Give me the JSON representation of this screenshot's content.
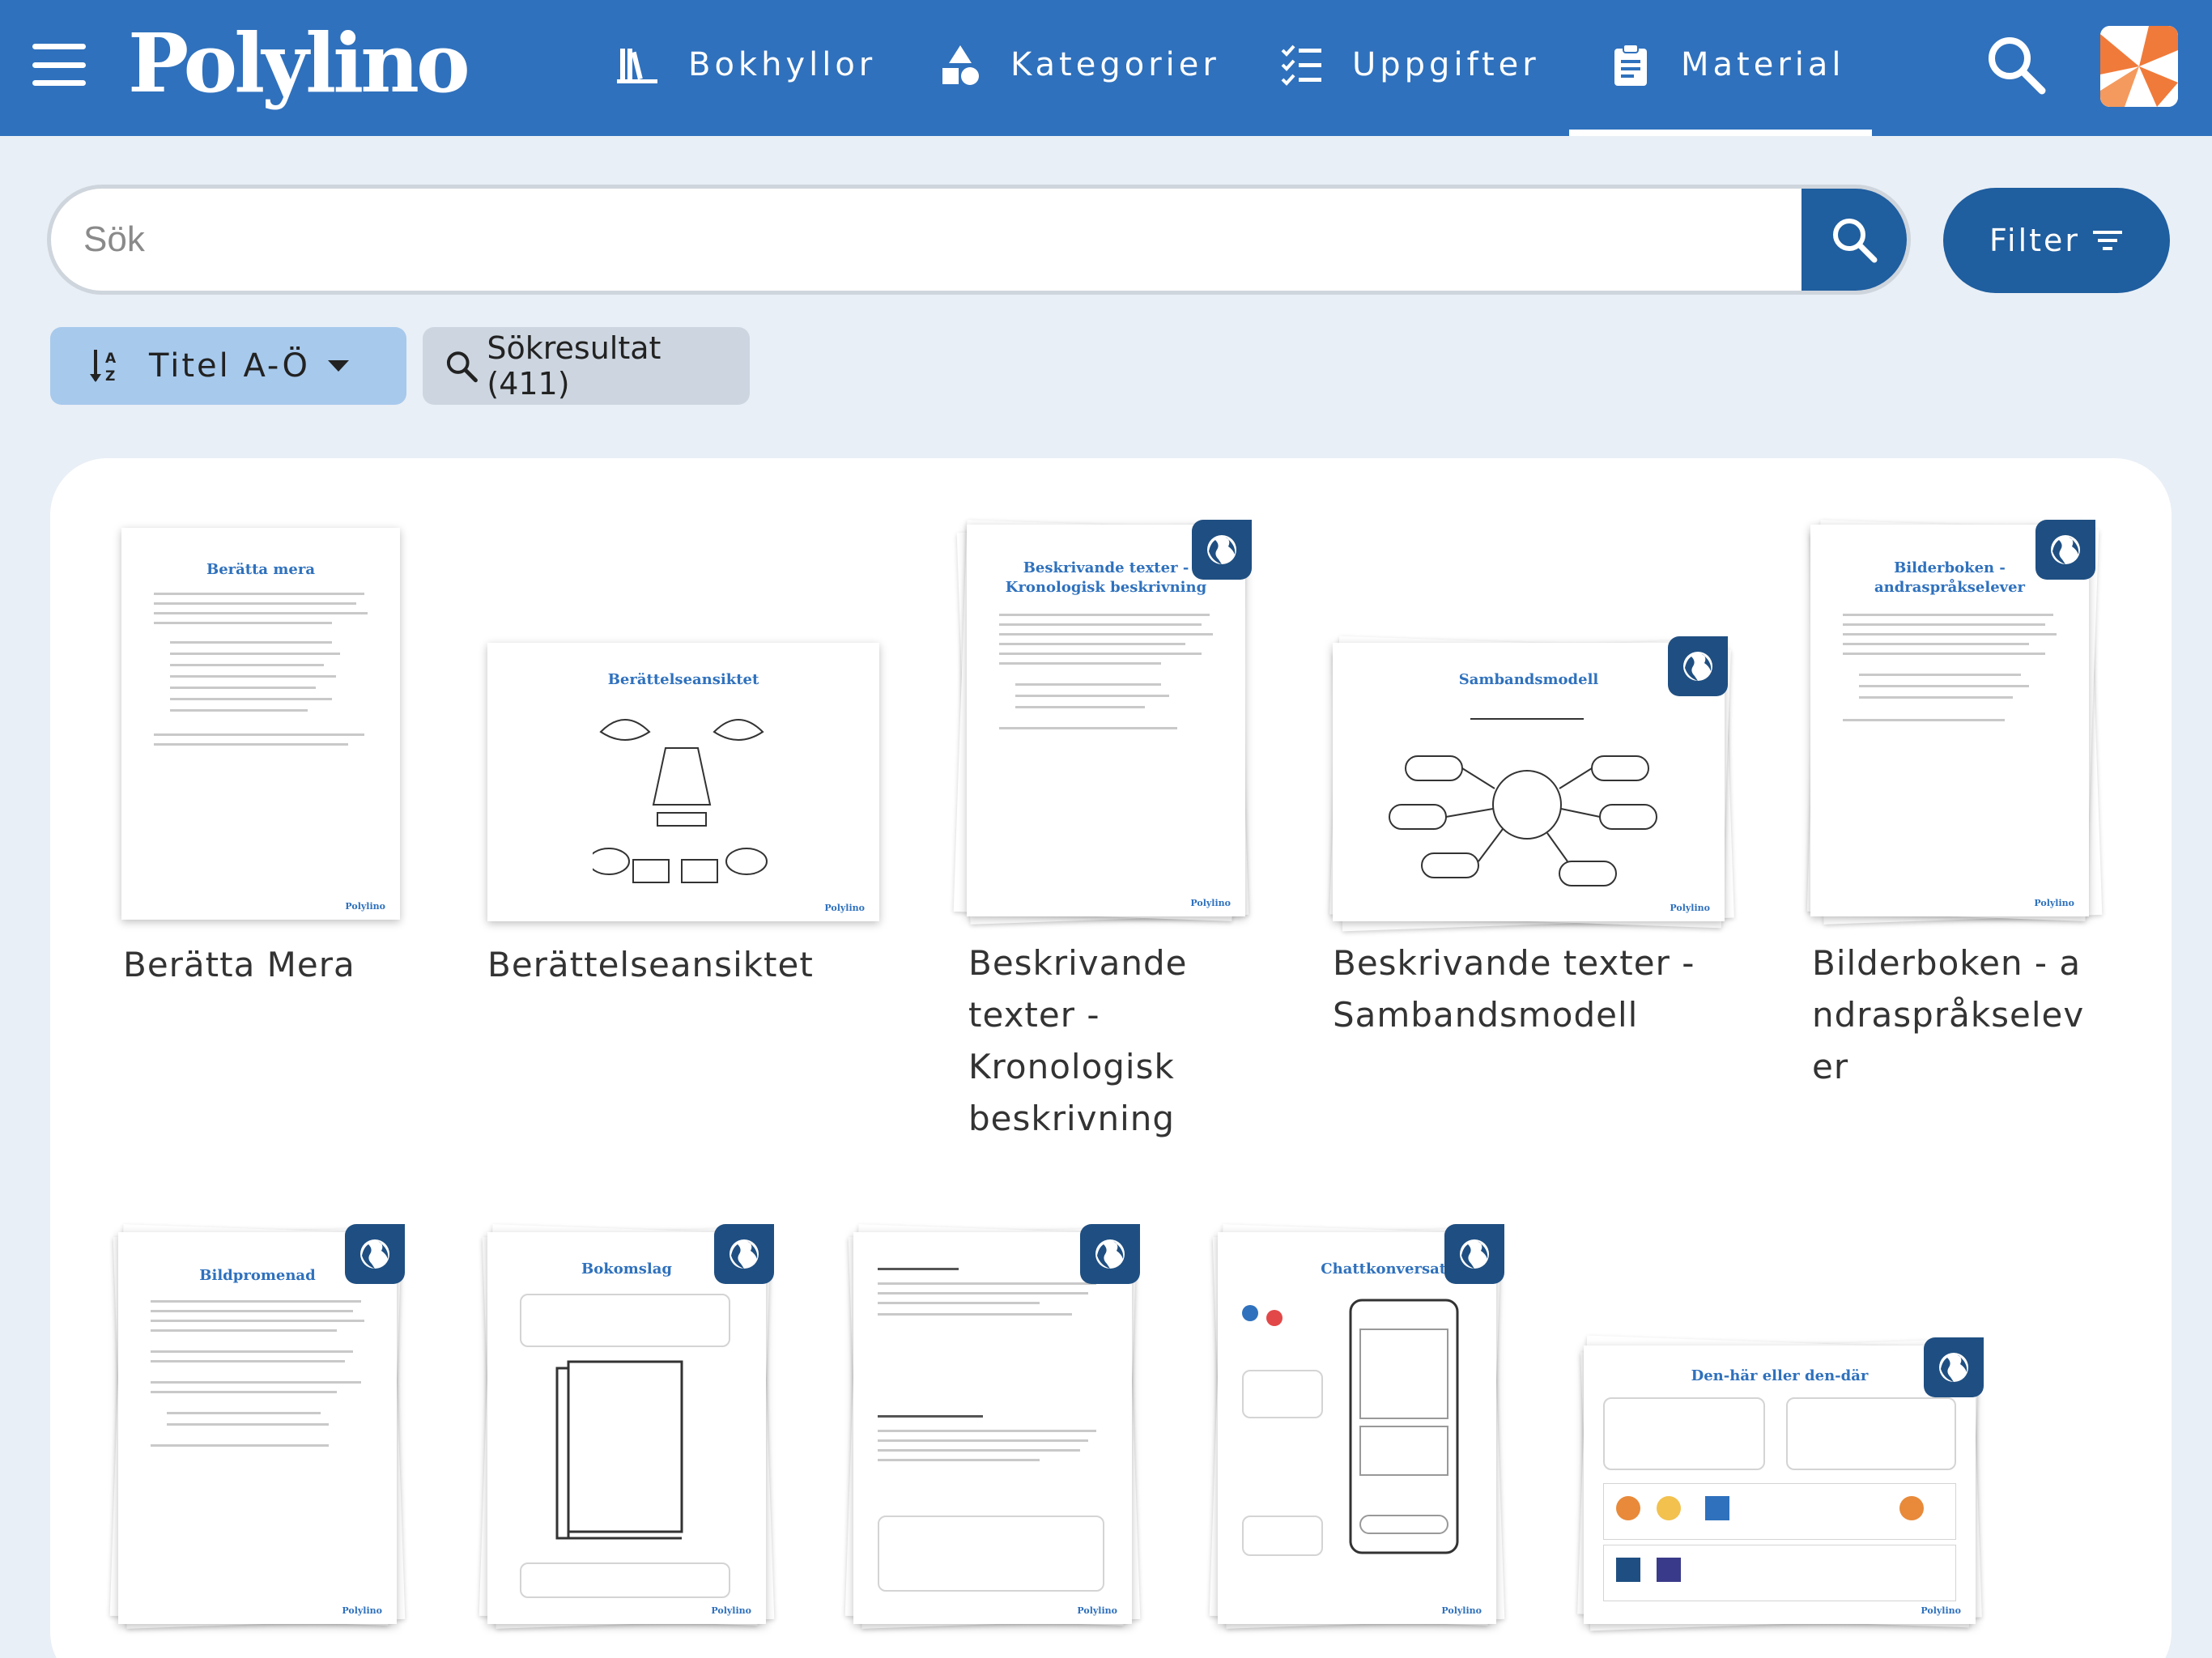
{
  "header": {
    "logo": "Polylino",
    "nav": [
      {
        "label": "Bokhyllor",
        "icon": "bookshelf-icon"
      },
      {
        "label": "Kategorier",
        "icon": "categories-icon"
      },
      {
        "label": "Uppgifter",
        "icon": "checklist-icon"
      },
      {
        "label": "Material",
        "icon": "clipboard-icon"
      }
    ],
    "active_nav": "Material"
  },
  "search": {
    "placeholder": "Sök"
  },
  "filter": {
    "label": "Filter"
  },
  "sort": {
    "label": "Titel A-Ö"
  },
  "results": {
    "label": "Sökresultat (411)"
  },
  "cards": [
    {
      "title": "Berätta Mera",
      "doc_title": "Berätta mera",
      "globe": false
    },
    {
      "title": "Berättelseansiktet",
      "doc_title": "Berättelseansiktet",
      "globe": false
    },
    {
      "title": "Beskrivande texter - Kronologisk beskrivning",
      "doc_title": "Beskrivande texter - Kronologisk beskrivning",
      "globe": true
    },
    {
      "title": "Beskrivande texter - Sambandsmodell",
      "doc_title": "Sambandsmodell",
      "globe": true
    },
    {
      "title": "Bilderboken - andraspråkselever",
      "doc_title": "Bilderboken - andraspråkselever",
      "globe": true
    },
    {
      "title": "Bildpromenad",
      "doc_title": "Bildpromenad",
      "globe": true
    },
    {
      "title": "Bokomslag",
      "doc_title": "Bokomslag",
      "globe": true
    },
    {
      "title": "",
      "doc_title": "",
      "globe": true
    },
    {
      "title": "",
      "doc_title": "Chattkonversation",
      "globe": true
    },
    {
      "title": "",
      "doc_title": "Den-här eller den-där",
      "globe": true
    }
  ],
  "brand_small": "Polylino",
  "colors": {
    "header": "#2f71bd",
    "dark_blue": "#1f5e9f",
    "sort_bg": "#a7c9ec",
    "chip_bg": "#cdd6e0",
    "page_bg": "#e9eff6"
  }
}
